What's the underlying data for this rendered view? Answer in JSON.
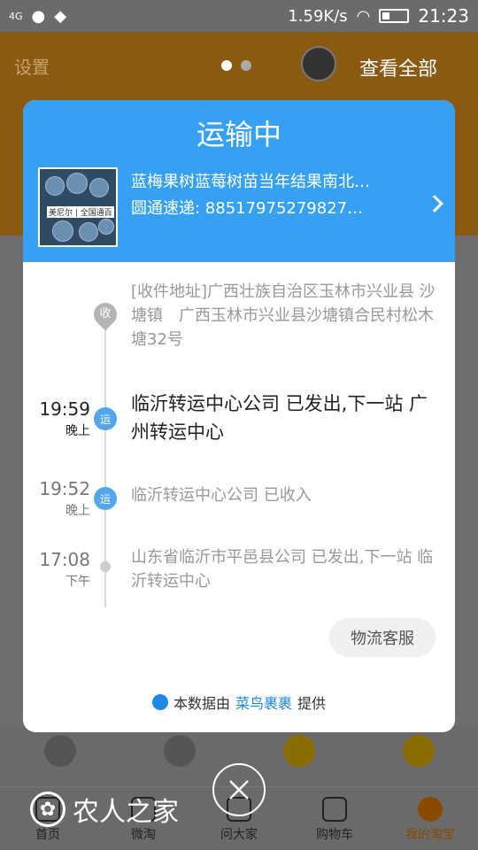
{
  "status_bar": {
    "signal": "4G",
    "speed": "1.59K/s",
    "time": "21:23"
  },
  "background": {
    "settings_label": "设置",
    "view_all_label": "查看全部",
    "tabs": [
      {
        "label": "首页"
      },
      {
        "label": "微淘"
      },
      {
        "label": "问大家"
      },
      {
        "label": "购物车"
      },
      {
        "label": "我的淘宝"
      }
    ]
  },
  "modal": {
    "title": "运输中",
    "item_title": "蓝梅果树蓝莓树苗当年结果南北…",
    "tracking": "圆通速递: 88517975279827…",
    "thumb_label": "美尼尔 | 全国通百",
    "address_badge": "收",
    "address": "[收件地址]广西壮族自治区玉林市兴业县 沙塘镇　广西玉林市兴业县沙塘镇合民村松木塘32号",
    "events": [
      {
        "time": "19:59",
        "ampm": "晚上",
        "badge": "运",
        "text": "临沂转运中心公司 已发出,下一站 广州转运中心"
      },
      {
        "time": "19:52",
        "ampm": "晚上",
        "badge": "运",
        "text": "临沂转运中心公司 已收入"
      },
      {
        "time": "17:08",
        "ampm": "下午",
        "badge": "",
        "text": "山东省临沂市平邑县公司 已发出,下一站 临沂转运中心"
      }
    ],
    "service_button": "物流客服",
    "footer_prefix": "本数据由",
    "footer_link": "菜鸟裹裹",
    "footer_suffix": "提供"
  },
  "watermark": {
    "text": "农人之家"
  }
}
